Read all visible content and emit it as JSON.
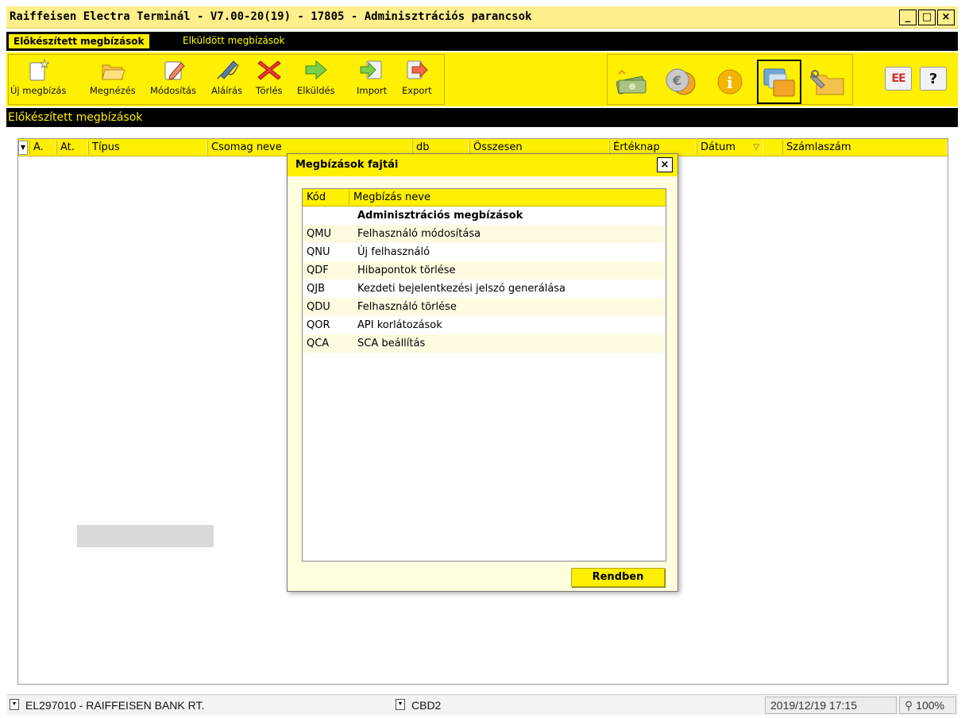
{
  "window": {
    "title": "Raiffeisen Electra Terminál - V7.00-20(19) - 17805 - Adminisztrációs parancsok",
    "minimize": "_",
    "maximize": "□",
    "close": "×"
  },
  "tabs": [
    {
      "label": "Előkészített megbízások",
      "active": true
    },
    {
      "label": "Elküldött megbízások",
      "active": false
    }
  ],
  "toolbar": {
    "buttons": [
      {
        "label": "Új megbízás",
        "icon": "new-doc-icon"
      },
      {
        "label": "Megnézés",
        "icon": "open-folder-icon"
      },
      {
        "label": "Módosítás",
        "icon": "edit-icon"
      },
      {
        "label": "Aláírás",
        "icon": "sign-pen-icon"
      },
      {
        "label": "Törlés",
        "icon": "delete-x-icon"
      },
      {
        "label": "Elküldés",
        "icon": "send-arrow-icon"
      },
      {
        "label": "Import",
        "icon": "import-icon"
      },
      {
        "label": "Export",
        "icon": "export-icon"
      }
    ],
    "right_icons": [
      "money-icon",
      "currency-icon",
      "info-icon",
      "admin-commands-icon",
      "settings-folder-icon"
    ],
    "exit_label": "EE",
    "help_label": "?"
  },
  "section_title": "Előkészített megbízások",
  "grid": {
    "columns": [
      "A.",
      "At.",
      "Típus",
      "Csomag neve",
      "db",
      "Összesen",
      "Értéknap",
      "Dátum",
      "Számlaszám"
    ],
    "sort_indicator": "▽"
  },
  "dialog": {
    "title": "Megbízások fajtái",
    "close": "×",
    "columns": [
      "Kód",
      "Megbízás neve"
    ],
    "group_label": "Adminisztrációs megbízások",
    "rows": [
      {
        "code": "QMU",
        "name": "Felhasználó módosítása"
      },
      {
        "code": "QNU",
        "name": "Új felhasználó"
      },
      {
        "code": "QDF",
        "name": "Hibapontok törlése"
      },
      {
        "code": "QJB",
        "name": "Kezdeti bejelentkezési jelszó generálása"
      },
      {
        "code": "QDU",
        "name": "Felhasználó törlése"
      },
      {
        "code": "QOR",
        "name": "API korlátozások"
      },
      {
        "code": "QCA",
        "name": "SCA beállítás"
      }
    ],
    "ok_label": "Rendben"
  },
  "statusbar": {
    "bank": "EL297010 - RAIFFEISEN BANK RT.",
    "branch": "CBD2",
    "datetime": "2019/12/19 17:15",
    "zoom": "100%"
  },
  "colors": {
    "accent_yellow": "#ffef00",
    "title_yellow": "#ffef8c",
    "black_bar": "#000000",
    "header_text_yellow": "#ffef00"
  }
}
